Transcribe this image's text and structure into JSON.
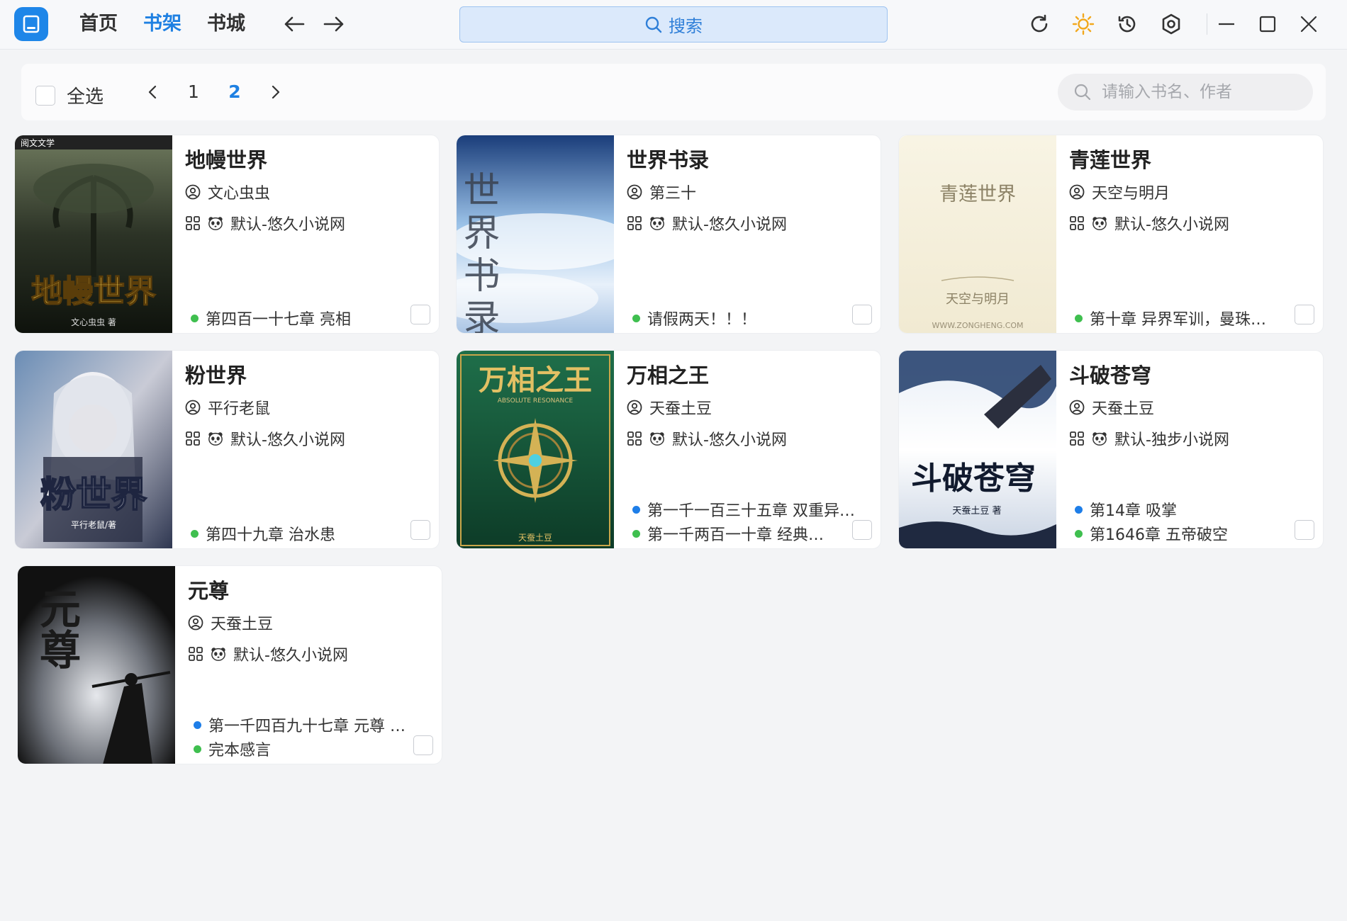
{
  "titlebar": {
    "nav": [
      "首页",
      "书架",
      "书城"
    ],
    "active_nav": 1,
    "search_label": "搜索",
    "accent": "#1e80e2"
  },
  "toolbar": {
    "select_all": "全选",
    "pages": [
      "1",
      "2"
    ],
    "current_page": "2",
    "filter_placeholder": "请输入书名、作者"
  },
  "books": [
    {
      "title": "地幔世界",
      "author": "文心虫虫",
      "source": "默认-悠久小说网",
      "chapters": [
        {
          "status": "green",
          "text": "第四百一十七章 亮相"
        }
      ]
    },
    {
      "title": "世界书录",
      "author": "第三十",
      "source": "默认-悠久小说网",
      "chapters": [
        {
          "status": "green",
          "text": "请假两天！！！"
        }
      ]
    },
    {
      "title": "青莲世界",
      "author": "天空与明月",
      "source": "默认-悠久小说网",
      "chapters": [
        {
          "status": "green",
          "text": "第十章 异界军训，曼珠…"
        }
      ]
    },
    {
      "title": "粉世界",
      "author": "平行老鼠",
      "source": "默认-悠久小说网",
      "chapters": [
        {
          "status": "green",
          "text": "第四十九章 治水患"
        }
      ]
    },
    {
      "title": "万相之王",
      "author": "天蚕土豆",
      "source": "默认-悠久小说网",
      "chapters": [
        {
          "status": "blue",
          "text": "第一千一百三十五章 双重异…"
        },
        {
          "status": "green",
          "text": "第一千两百一十章 经典…"
        }
      ]
    },
    {
      "title": "斗破苍穹",
      "author": "天蚕土豆",
      "source": "默认-独步小说网",
      "chapters": [
        {
          "status": "blue",
          "text": "第14章 吸掌"
        },
        {
          "status": "green",
          "text": "第1646章 五帝破空"
        }
      ]
    },
    {
      "title": "元尊",
      "author": "天蚕土豆",
      "source": "默认-悠久小说网",
      "chapters": [
        {
          "status": "blue",
          "text": "第一千四百九十七章 元尊 …"
        },
        {
          "status": "green",
          "text": "完本感言"
        }
      ]
    }
  ],
  "covers": [
    {
      "text": "地幔世界",
      "sub": "文心虫虫 著",
      "top_tag": "阅文文学"
    },
    {
      "text": "世界书录",
      "sub": "",
      "top_tag": ""
    },
    {
      "text": "青莲世界",
      "sub": "天空与明月",
      "top_tag": "WWW.ZONGHENG.COM"
    },
    {
      "text": "粉世界",
      "sub": "平行老鼠/著",
      "top_tag": ""
    },
    {
      "text": "万相之王",
      "sub": "天蚕土豆",
      "top_tag": "ABSOLUTE RESONANCE"
    },
    {
      "text": "斗破苍穹",
      "sub": "天蚕土豆 著",
      "top_tag": ""
    },
    {
      "text": "元尊",
      "sub": "",
      "top_tag": ""
    }
  ]
}
